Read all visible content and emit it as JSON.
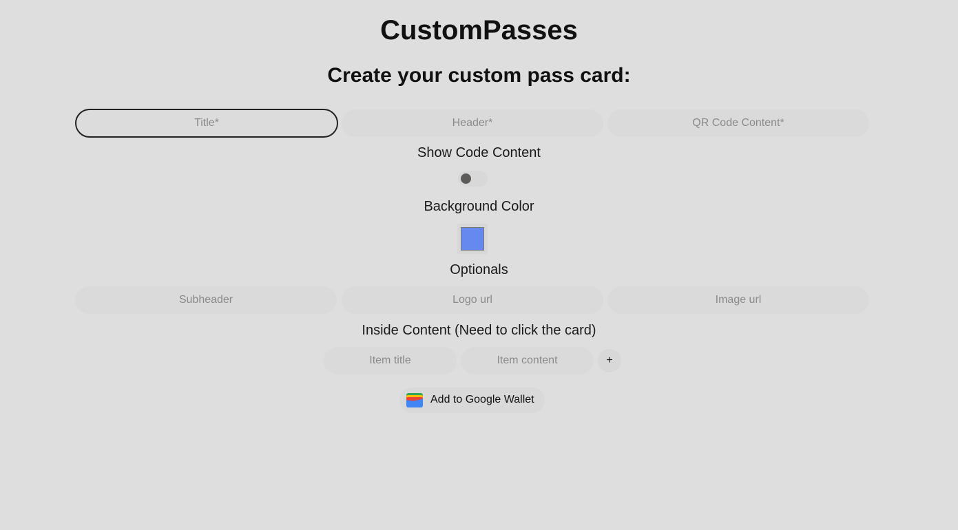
{
  "app": {
    "title": "CustomPasses",
    "subtitle": "Create your custom pass card:"
  },
  "required_fields": [
    {
      "name": "title",
      "placeholder": "Title*",
      "value": ""
    },
    {
      "name": "header",
      "placeholder": "Header*",
      "value": ""
    },
    {
      "name": "qr",
      "placeholder": "QR Code Content*",
      "value": ""
    }
  ],
  "show_code": {
    "label": "Show Code Content",
    "enabled": false
  },
  "background": {
    "label": "Background Color",
    "color": "#6689ef"
  },
  "optionals": {
    "label": "Optionals",
    "fields": [
      {
        "placeholder": "Subheader",
        "value": ""
      },
      {
        "placeholder": "Logo url",
        "value": ""
      },
      {
        "placeholder": "Image url",
        "value": ""
      }
    ]
  },
  "inside": {
    "label": "Inside Content (Need to click the card)",
    "item_title_placeholder": "Item title",
    "item_content_placeholder": "Item content",
    "add_label": "+"
  },
  "wallet_button": {
    "label": "Add to Google Wallet",
    "icon": "google-wallet-icon"
  }
}
